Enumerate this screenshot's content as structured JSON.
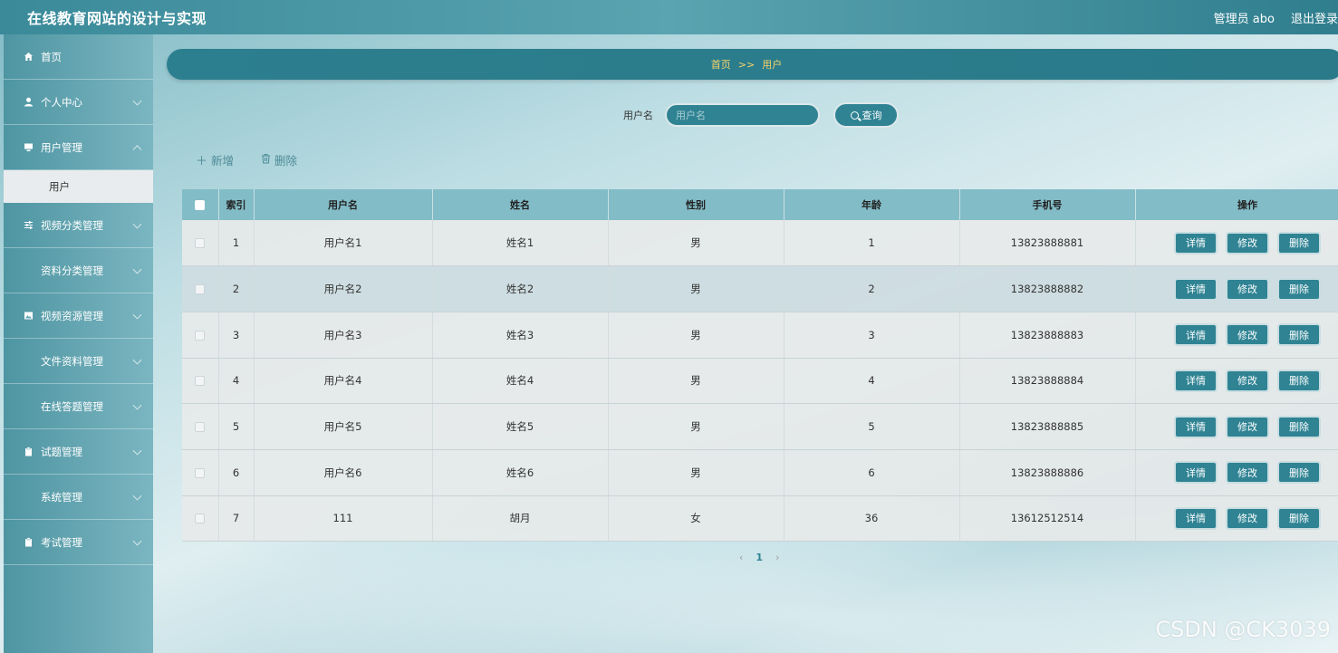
{
  "header": {
    "title": "在线教育网站的设计与实现",
    "user": "管理员 abo",
    "logout": "退出登录"
  },
  "sidebar": {
    "items": [
      {
        "label": "首页",
        "icon": "home-icon"
      },
      {
        "label": "个人中心",
        "icon": "user-icon"
      },
      {
        "label": "用户管理",
        "icon": "monitor-icon"
      },
      {
        "label": "视频分类管理",
        "icon": "sliders-icon"
      },
      {
        "label": "资料分类管理",
        "icon": "grid-icon"
      },
      {
        "label": "视频资源管理",
        "icon": "image-icon"
      },
      {
        "label": "文件资料管理",
        "icon": "grid-icon"
      },
      {
        "label": "在线答题管理",
        "icon": "grid9-icon"
      },
      {
        "label": "试题管理",
        "icon": "clipboard-icon"
      },
      {
        "label": "系统管理",
        "icon": "grid-icon"
      },
      {
        "label": "考试管理",
        "icon": "clipboard-icon"
      }
    ],
    "submenu": {
      "label": "用户"
    }
  },
  "breadcrumb": {
    "home": "首页",
    "sep": ">>",
    "current": "用户"
  },
  "search": {
    "label": "用户名",
    "placeholder": "用户名",
    "button": "查询"
  },
  "actions": {
    "add": "新增",
    "delete": "删除"
  },
  "table": {
    "headers": [
      "索引",
      "用户名",
      "姓名",
      "性别",
      "年龄",
      "手机号",
      "操作"
    ],
    "rows": [
      {
        "index": "1",
        "username": "用户名1",
        "name": "姓名1",
        "gender": "男",
        "age": "1",
        "phone": "13823888881"
      },
      {
        "index": "2",
        "username": "用户名2",
        "name": "姓名2",
        "gender": "男",
        "age": "2",
        "phone": "13823888882"
      },
      {
        "index": "3",
        "username": "用户名3",
        "name": "姓名3",
        "gender": "男",
        "age": "3",
        "phone": "13823888883"
      },
      {
        "index": "4",
        "username": "用户名4",
        "name": "姓名4",
        "gender": "男",
        "age": "4",
        "phone": "13823888884"
      },
      {
        "index": "5",
        "username": "用户名5",
        "name": "姓名5",
        "gender": "男",
        "age": "5",
        "phone": "13823888885"
      },
      {
        "index": "6",
        "username": "用户名6",
        "name": "姓名6",
        "gender": "男",
        "age": "6",
        "phone": "13823888886"
      },
      {
        "index": "7",
        "username": "111",
        "name": "胡月",
        "gender": "女",
        "age": "36",
        "phone": "13612512514"
      }
    ],
    "row_buttons": {
      "detail": "详情",
      "edit": "修改",
      "delete": "删除"
    }
  },
  "pagination": {
    "prev": "‹",
    "current": "1",
    "next": "›"
  },
  "watermark": "CSDN @CK3039",
  "colors": {
    "primary": "#2f8393",
    "accent": "#f6d36b",
    "header_bg": "#82bcc7"
  }
}
